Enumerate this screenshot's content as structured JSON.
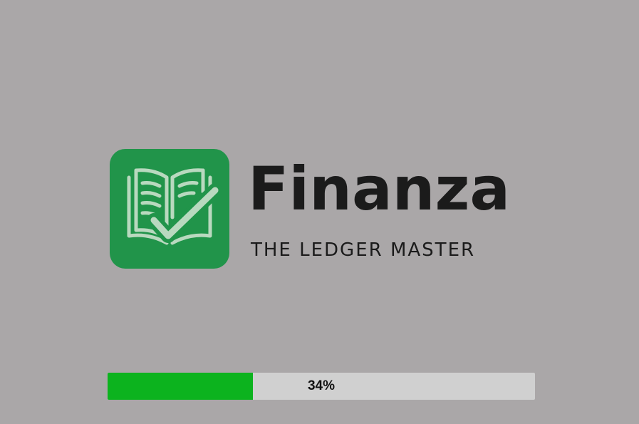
{
  "app": {
    "name": "Finanza",
    "tagline": "THE LEDGER MASTER"
  },
  "logo": {
    "icon": "open-ledger-checkmark-icon",
    "background_color": "#21944a",
    "foreground_color": "#b9d9bf"
  },
  "loading": {
    "progress_fraction": 0.34,
    "progress_label": "34%",
    "fill_color": "#0cb31e",
    "track_color": "#d0d0d0"
  },
  "background_color": "#aaa7a8"
}
